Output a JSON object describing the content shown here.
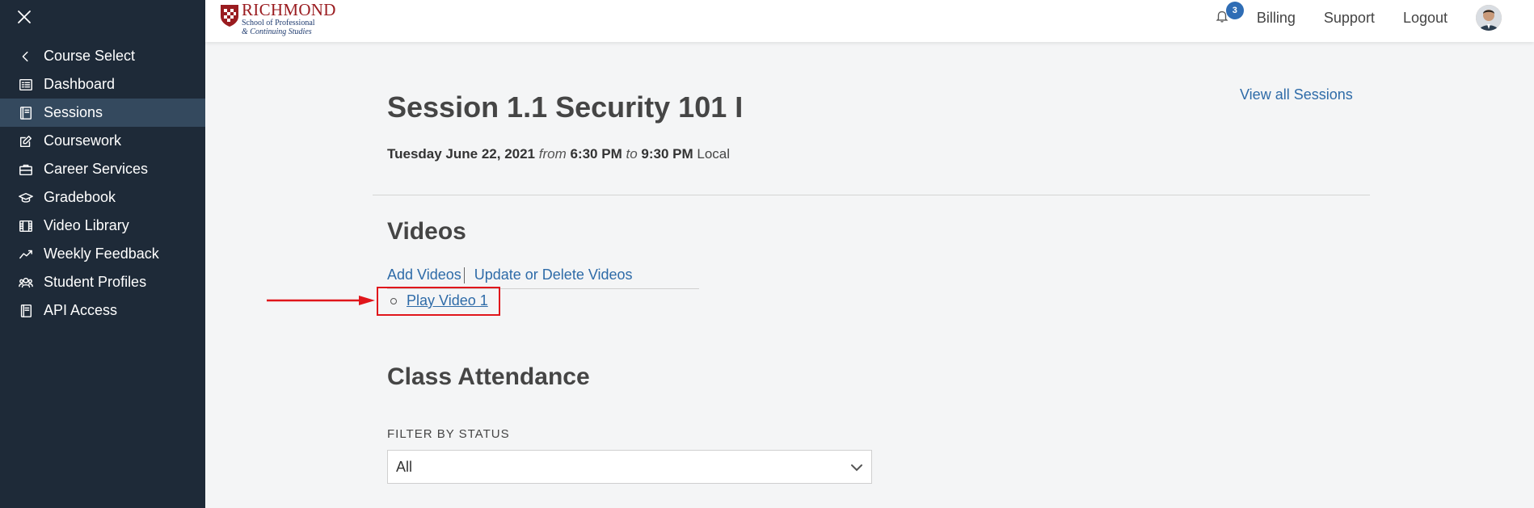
{
  "sidebar": {
    "items": [
      {
        "label": "Course Select",
        "icon": "chevron-left-icon"
      },
      {
        "label": "Dashboard",
        "icon": "dashboard-icon"
      },
      {
        "label": "Sessions",
        "icon": "sessions-icon"
      },
      {
        "label": "Coursework",
        "icon": "edit-icon"
      },
      {
        "label": "Career Services",
        "icon": "briefcase-icon"
      },
      {
        "label": "Gradebook",
        "icon": "graduation-cap-icon"
      },
      {
        "label": "Video Library",
        "icon": "film-icon"
      },
      {
        "label": "Weekly Feedback",
        "icon": "chart-line-icon"
      },
      {
        "label": "Student Profiles",
        "icon": "users-icon"
      },
      {
        "label": "API Access",
        "icon": "book-icon"
      }
    ],
    "active_item": "Sessions"
  },
  "header": {
    "logo": {
      "main": "RICHMOND",
      "line1": "School of Professional",
      "line2": "& Continuing Studies"
    },
    "notification_count": "3",
    "links": {
      "billing": "Billing",
      "support": "Support",
      "logout": "Logout"
    }
  },
  "session": {
    "title": "Session 1.1 Security 101 I",
    "view_all": "View all Sessions",
    "date": "Tuesday June 22, 2021",
    "from_word": "from",
    "start_time": "6:30 PM",
    "to_word": "to",
    "end_time": "9:30 PM",
    "timezone": "Local"
  },
  "videos": {
    "heading": "Videos",
    "add_label": "Add Videos",
    "update_label": "Update or Delete Videos",
    "items": [
      "Play Video 1"
    ]
  },
  "attendance": {
    "heading": "Class Attendance",
    "filter_label": "FILTER BY STATUS",
    "filter_value": "All"
  },
  "colors": {
    "sidebar_bg": "#1e2a38",
    "sidebar_active": "#34495e",
    "link": "#2e6ba8",
    "highlight": "#e0161b"
  }
}
